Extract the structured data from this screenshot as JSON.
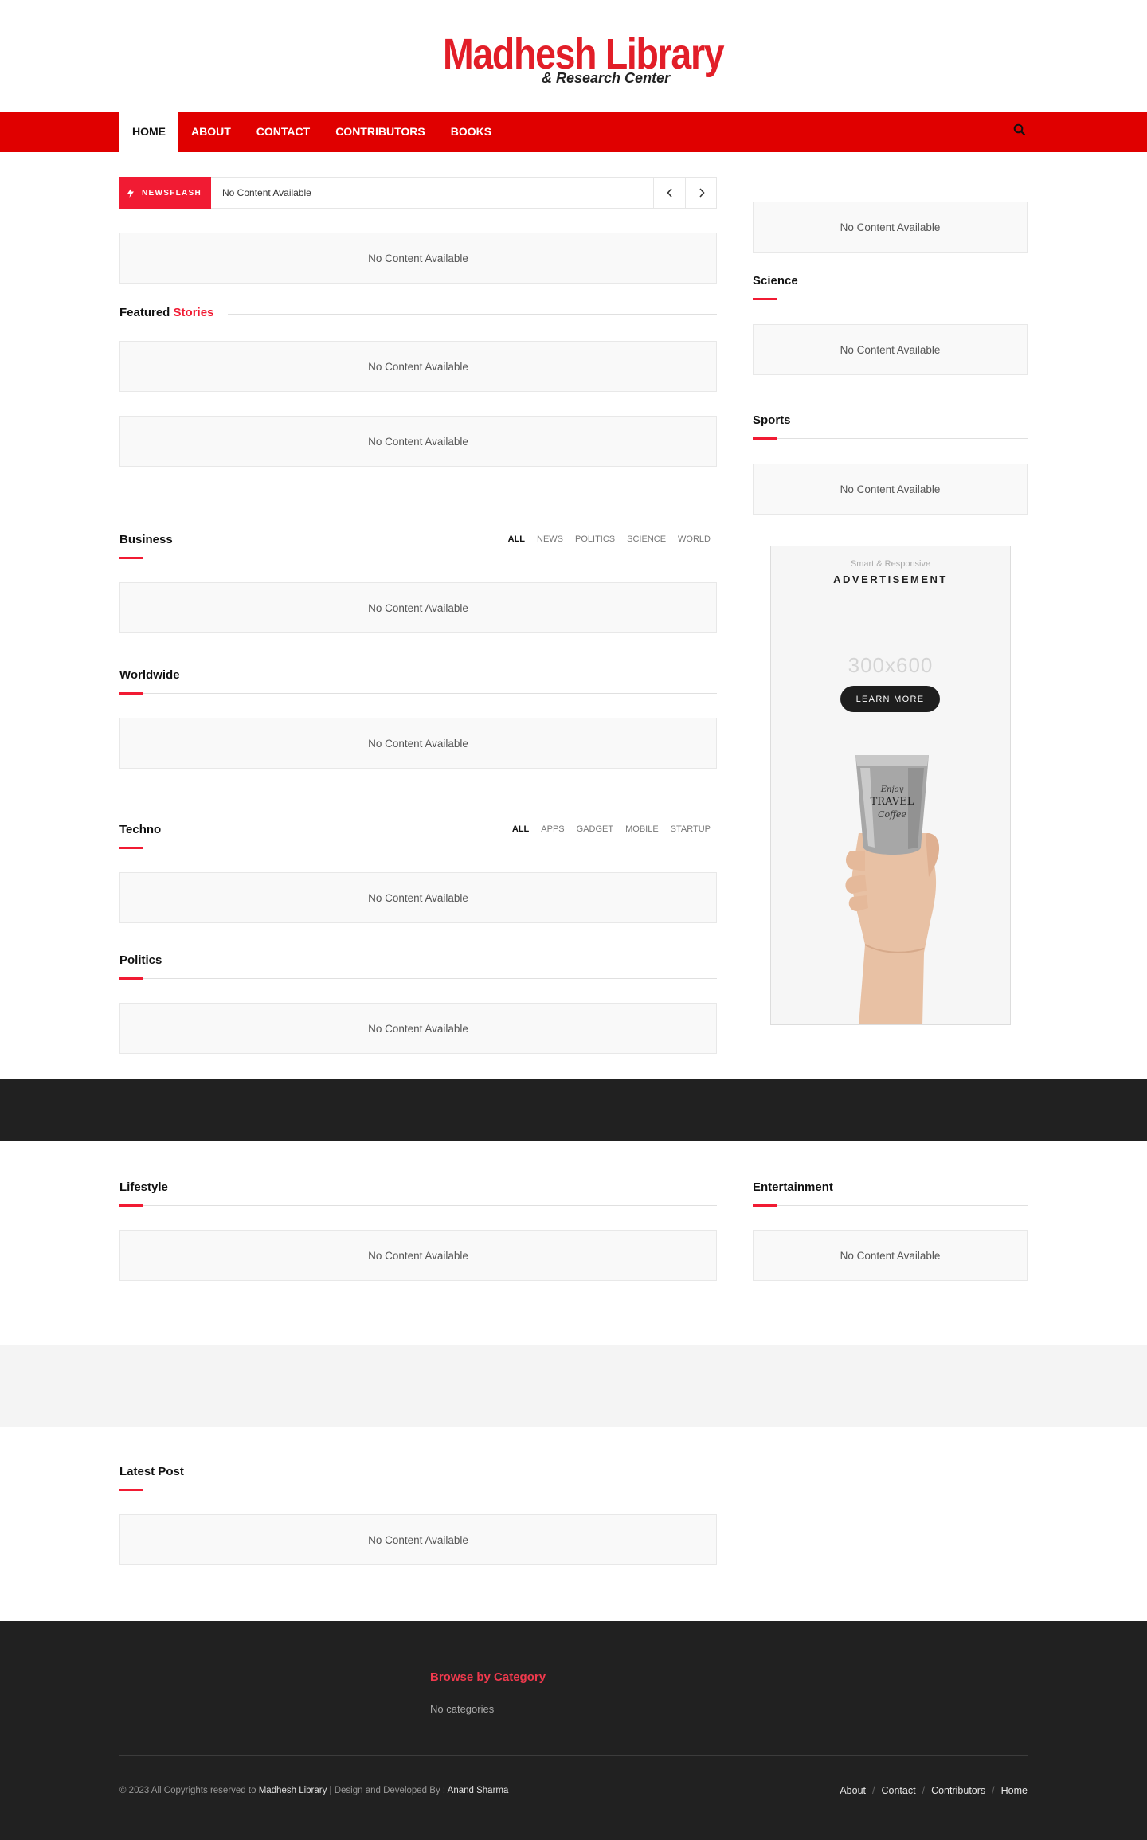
{
  "header": {
    "logo_main": "Madhesh Library",
    "logo_sub": "& Research Center"
  },
  "nav": {
    "items": [
      "HOME",
      "ABOUT",
      "CONTACT",
      "CONTRIBUTORS",
      "BOOKS"
    ],
    "active": "HOME",
    "search_icon": "search-icon"
  },
  "newsflash": {
    "label": "NEWSFLASH",
    "text": "No Content Available",
    "prev_icon": "chevron-left-icon",
    "next_icon": "chevron-right-icon"
  },
  "empty_text": "No Content Available",
  "featured": {
    "title_plain": "Featured",
    "title_accent": "Stories"
  },
  "sections": {
    "business": {
      "title": "Business",
      "tabs": [
        "ALL",
        "NEWS",
        "POLITICS",
        "SCIENCE",
        "WORLD"
      ]
    },
    "worldwide": {
      "title": "Worldwide"
    },
    "techno": {
      "title": "Techno",
      "tabs": [
        "ALL",
        "APPS",
        "GADGET",
        "MOBILE",
        "STARTUP"
      ]
    },
    "politics": {
      "title": "Politics"
    },
    "science": {
      "title": "Science"
    },
    "sports": {
      "title": "Sports"
    },
    "lifestyle": {
      "title": "Lifestyle"
    },
    "entertainment": {
      "title": "Entertainment"
    },
    "latest_post": {
      "title": "Latest Post"
    }
  },
  "ad": {
    "small_text": "Smart & Responsive",
    "big_text": "ADVERTISEMENT",
    "size_text": "300x600",
    "button": "LEARN MORE",
    "cup_text": [
      "Enjoy",
      "TRAVEL",
      "Coffee"
    ]
  },
  "footer": {
    "browse_title": "Browse by Category",
    "no_categories": "No categories",
    "copyright_prefix": "© 2023 All Copyrights reserved to ",
    "copyright_site": "Madhesh Library",
    "copyright_mid": " | Design and Developed By : ",
    "copyright_author": "Anand Sharma",
    "links": [
      "About",
      "Contact",
      "Contributors",
      "Home"
    ]
  },
  "colors": {
    "brand_red": "#e00000",
    "accent_red": "#f11b33",
    "dark": "#212121"
  }
}
